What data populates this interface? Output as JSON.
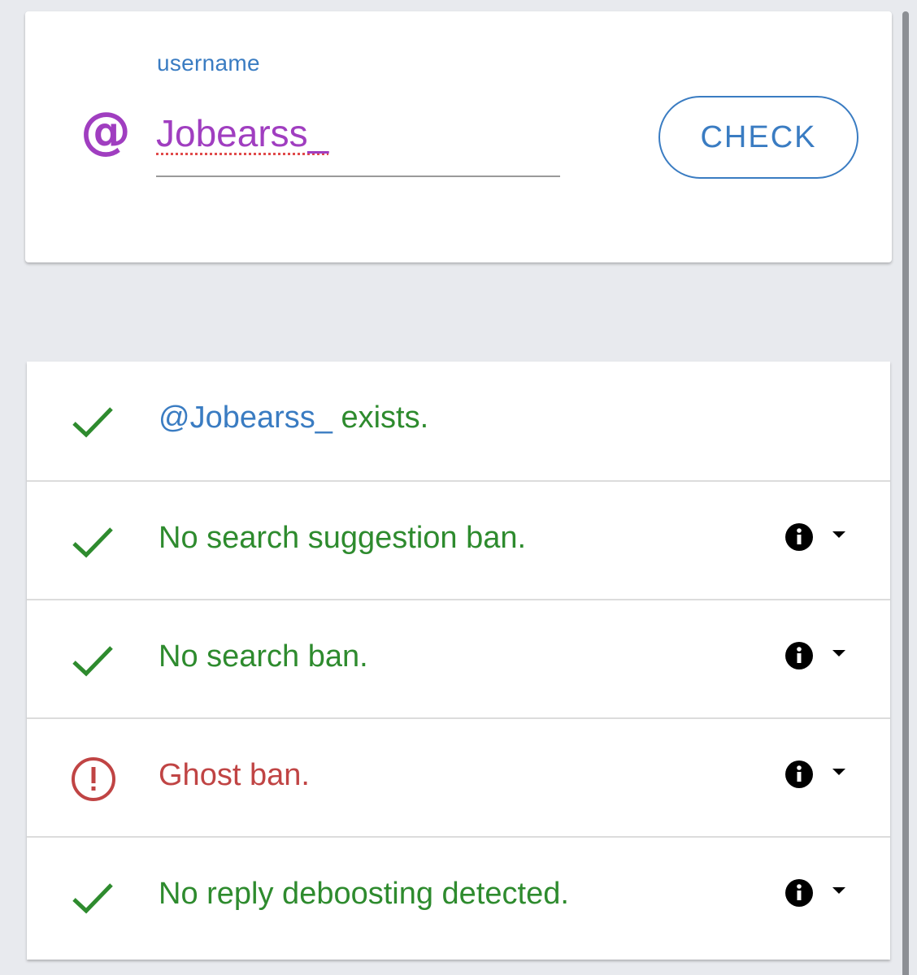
{
  "search": {
    "field_label": "username",
    "at_symbol": "@",
    "username_value": "Jobearss_",
    "check_label": "CHECK"
  },
  "results": [
    {
      "status": "ok",
      "handle": "@Jobearss_",
      "text": " exists.",
      "has_info": false
    },
    {
      "status": "ok",
      "handle": "",
      "text": "No search suggestion ban.",
      "has_info": true
    },
    {
      "status": "ok",
      "handle": "",
      "text": "No search ban.",
      "has_info": true
    },
    {
      "status": "error",
      "handle": "",
      "text": "Ghost ban.",
      "has_info": true
    },
    {
      "status": "ok",
      "handle": "",
      "text": "No reply deboosting detected.",
      "has_info": true
    }
  ],
  "colors": {
    "accent_blue": "#3a7cc2",
    "brand_purple": "#a03ec0",
    "success_green": "#2e8b2e",
    "error_red": "#c04444"
  },
  "icons": {
    "ok": "check-icon",
    "error": "alert-circle-icon",
    "info": "info-icon",
    "expand": "chevron-down-icon"
  }
}
